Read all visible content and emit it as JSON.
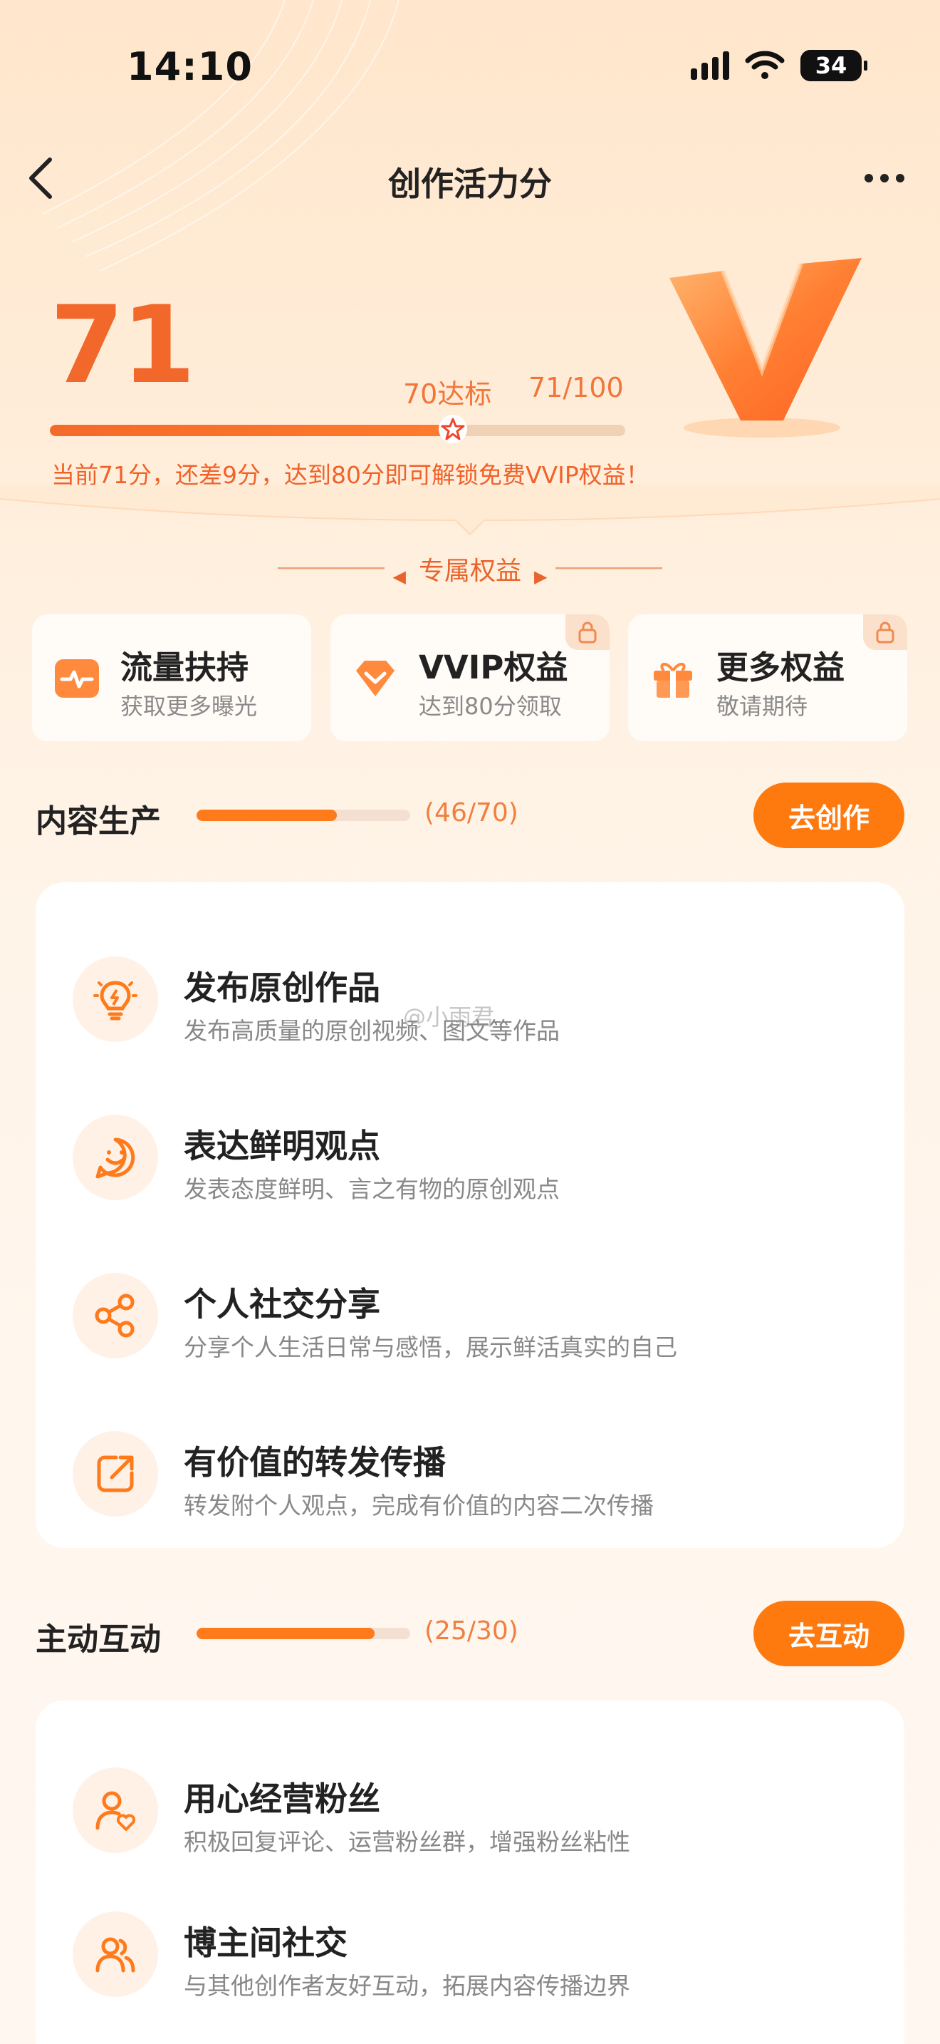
{
  "status_bar": {
    "time": "14:10",
    "battery": "34"
  },
  "nav": {
    "title": "创作活力分"
  },
  "score": {
    "value": "71",
    "standard_label": "70达标",
    "ratio": "71/100",
    "progress": 0.71,
    "hint": "当前71分，还差9分，达到80分即可解锁免费VVIP权益！"
  },
  "exclusive": {
    "label": "专属权益"
  },
  "perks": [
    {
      "title": "流量扶持",
      "subtitle": "获取更多曝光",
      "icon": "traffic-icon",
      "locked": false
    },
    {
      "title": "VVIP权益",
      "subtitle": "达到80分领取",
      "icon": "diamond-icon",
      "locked": true
    },
    {
      "title": "更多权益",
      "subtitle": "敬请期待",
      "icon": "gift-icon",
      "locked": true
    }
  ],
  "sections": [
    {
      "name": "内容生产",
      "count": "(46/70)",
      "progress": 0.657,
      "button": "去创作",
      "items": [
        {
          "title": "发布原创作品",
          "subtitle": "发布高质量的原创视频、图文等作品",
          "icon": "bulb-icon"
        },
        {
          "title": "表达鲜明观点",
          "subtitle": "发表态度鲜明、言之有物的原创观点",
          "icon": "chat-smile-icon"
        },
        {
          "title": "个人社交分享",
          "subtitle": "分享个人生活日常与感悟，展示鲜活真实的自己",
          "icon": "share-icon"
        },
        {
          "title": "有价值的转发传播",
          "subtitle": "转发附个人观点，完成有价值的内容二次传播",
          "icon": "forward-icon"
        }
      ]
    },
    {
      "name": "主动互动",
      "count": "(25/30)",
      "progress": 0.833,
      "button": "去互动",
      "items": [
        {
          "title": "用心经营粉丝",
          "subtitle": "积极回复评论、运营粉丝群，增强粉丝粘性",
          "icon": "user-heart-icon"
        },
        {
          "title": "博主间社交",
          "subtitle": "与其他创作者友好互动，拓展内容传播边界",
          "icon": "users-icon"
        }
      ]
    }
  ],
  "watermark": "@小雨君",
  "colors": {
    "accent": "#ff7a0e",
    "score": "#f2672a"
  }
}
